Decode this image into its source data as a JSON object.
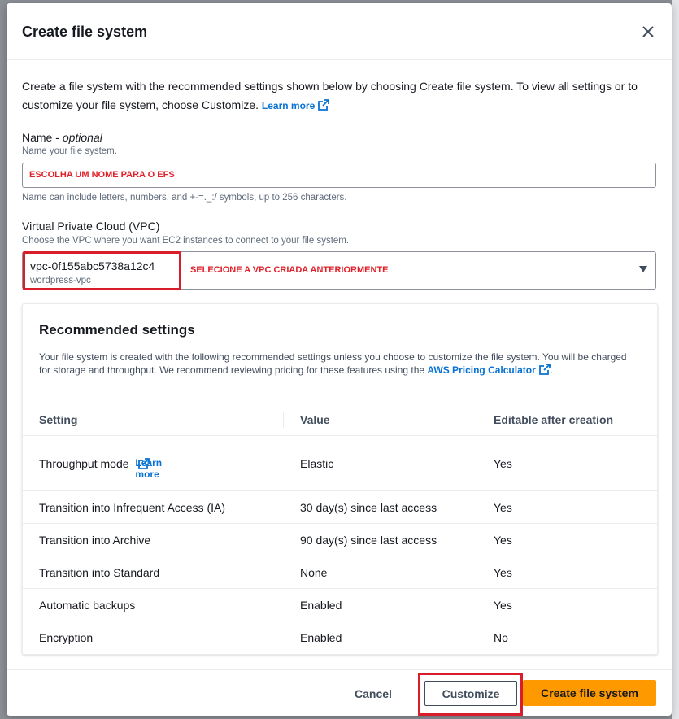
{
  "modal": {
    "title": "Create file system",
    "intro": "Create a file system with the recommended settings shown below by choosing Create file system. To view all settings or to customize your file system, choose Customize.",
    "intro_link": "Learn more"
  },
  "name_field": {
    "label": "Name",
    "label_optional": "optional",
    "description": "Name your file system.",
    "value": "ESCOLHA UM NOME PARA O EFS",
    "constraint": "Name can include letters, numbers, and +-=._:/ symbols, up to 256 characters."
  },
  "vpc_field": {
    "label": "Virtual Private Cloud (VPC)",
    "description": "Choose the VPC where you want EC2 instances to connect to your file system.",
    "vpc_id": "vpc-0f155abc5738a12c4",
    "vpc_name": "wordpress-vpc",
    "annotation": "SELECIONE A VPC CRIADA ANTERIORMENTE"
  },
  "recommended": {
    "title": "Recommended settings",
    "description": "Your file system is created with the following recommended settings unless you choose to customize the file system. You will be charged for storage and throughput. We recommend reviewing pricing for these features using the",
    "calculator_link": "AWS Pricing Calculator",
    "description_end": ".",
    "columns": [
      "Setting",
      "Value",
      "Editable after creation"
    ],
    "rows": [
      {
        "setting": "Throughput mode",
        "link": "Learn more",
        "value": "Elastic",
        "editable": "Yes"
      },
      {
        "setting": "Transition into Infrequent Access (IA)",
        "value": "30 day(s) since last access",
        "editable": "Yes"
      },
      {
        "setting": "Transition into Archive",
        "value": "90 day(s) since last access",
        "editable": "Yes"
      },
      {
        "setting": "Transition into Standard",
        "value": "None",
        "editable": "Yes"
      },
      {
        "setting": "Automatic backups",
        "value": "Enabled",
        "editable": "Yes"
      },
      {
        "setting": "Encryption",
        "value": "Enabled",
        "editable": "No"
      }
    ]
  },
  "footer": {
    "cancel": "Cancel",
    "customize": "Customize",
    "create": "Create file system"
  },
  "colors": {
    "accent_link": "#0972d3",
    "primary_button": "#ff9900",
    "annotation_red": "#e0202a"
  }
}
